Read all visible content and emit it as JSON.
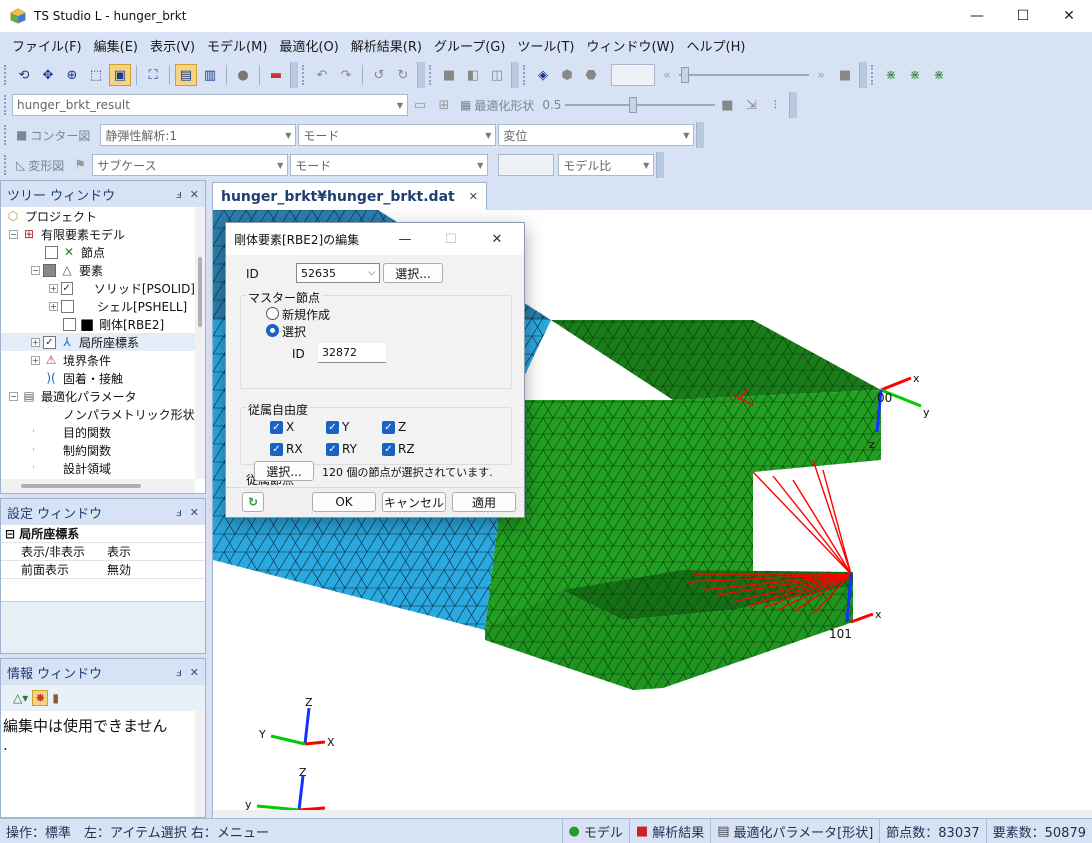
{
  "window": {
    "title": "TS Studio L - hunger_brkt",
    "minimize": "—",
    "maximize": "☐",
    "close": "✕"
  },
  "menu": [
    "ファイル(F)",
    "編集(E)",
    "表示(V)",
    "モデル(M)",
    "最適化(O)",
    "解析結果(R)",
    "グループ(G)",
    "ツール(T)",
    "ウィンドウ(W)",
    "ヘルプ(H)"
  ],
  "toolbar": {
    "result_combo": "hunger_brkt_result",
    "optshape_label": "最適化形状",
    "optshape_value": "0.5",
    "contour_label": "コンター図",
    "analysis_combo": "静弾性解析:1",
    "mode_combo_1": "モード",
    "variable_combo": "変位",
    "deform_label": "変形図",
    "subcase_combo": "サブケース",
    "mode_combo_2": "モード",
    "model_ratio_combo": "モデル比"
  },
  "tree_window": {
    "title": "ツリー ウィンドウ",
    "items": [
      {
        "label": "プロジェクト"
      },
      {
        "label": "有限要素モデル"
      },
      {
        "label": "節点"
      },
      {
        "label": "要素"
      },
      {
        "label": "ソリッド[PSOLID]"
      },
      {
        "label": "シェル[PSHELL]"
      },
      {
        "label": "剛体[RBE2]"
      },
      {
        "label": "局所座標系"
      },
      {
        "label": "境界条件"
      },
      {
        "label": "固着・接触"
      },
      {
        "label": "最適化パラメータ"
      },
      {
        "label": "ノンパラメトリック形状最適"
      },
      {
        "label": "目的関数"
      },
      {
        "label": "制約関数"
      },
      {
        "label": "設計領域"
      }
    ]
  },
  "settings_window": {
    "title": "設定 ウィンドウ",
    "category": "局所座標系",
    "rows": [
      {
        "key": "表示/非表示",
        "value": "表示"
      },
      {
        "key": "前面表示",
        "value": "無効"
      }
    ]
  },
  "info_window": {
    "title": "情報 ウィンドウ",
    "message": "編集中は使用できません",
    "message2": "."
  },
  "doc_tab": {
    "label": "hunger_brkt¥hunger_brkt.dat",
    "close": "✕"
  },
  "dialog": {
    "title": "剛体要素[RBE2]の編集",
    "id_label": "ID",
    "id_value": "52635",
    "select_button": "選択...",
    "master_group": "マスター節点",
    "radio_new": "新規作成",
    "radio_select": "選択",
    "master_id_label": "ID",
    "master_id_value": "32872",
    "dof_group": "従属自由度",
    "dof": [
      "X",
      "Y",
      "Z",
      "RX",
      "RY",
      "RZ"
    ],
    "dependent_label": "従属節点",
    "dependent_select_button": "選択...",
    "dependent_status": "120 個の節点が選択されています.",
    "ok": "OK",
    "cancel": "キャンセル",
    "apply": "適用"
  },
  "viewport": {
    "node_label_1": "00",
    "node_label_2": "101",
    "axis": {
      "x": "X",
      "y": "Y",
      "z": "Z",
      "x_lower": "x",
      "y_lower": "y",
      "z_lower": "z"
    }
  },
  "status": {
    "main": "操作：標準　左：アイテム選択 右：メニュー",
    "model": "モデル",
    "result": "解析結果",
    "optparam": "最適化パラメータ[形状]",
    "nodes": "節点数：83037",
    "elements": "要素数：50879"
  },
  "colors": {
    "accent": "#1a63c4",
    "mesh_green": "#1e9a1e",
    "mesh_blue": "#2aa0d8",
    "rbe_red": "#ff0000"
  }
}
